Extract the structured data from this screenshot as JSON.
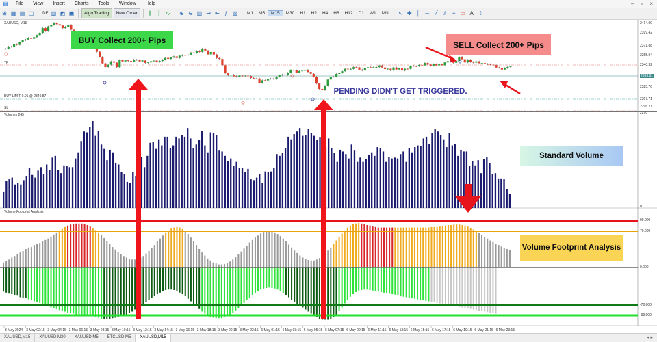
{
  "menu": {
    "items": [
      "File",
      "View",
      "Insert",
      "Charts",
      "Tools",
      "Window",
      "Help"
    ]
  },
  "toolbar": {
    "algo_trading": "Algo Trading",
    "new_order": "New Order",
    "timeframes": [
      "M1",
      "M5",
      "M15",
      "M30",
      "H1",
      "H2",
      "H4",
      "H6",
      "H12",
      "D1",
      "W1",
      "MN"
    ],
    "active_timeframe": "M15"
  },
  "chart": {
    "header": "XAUUSD, M15",
    "tp_label": "TP",
    "sl_label": "SL",
    "pending_label": "BUY LIMIT 0.01 @ 2340.87",
    "right_prices": [
      "2414.90",
      "2399.42",
      "2371.88",
      "2355.94",
      "2340.32",
      "2333.81",
      "2325.70",
      "2307.71",
      "2296.21",
      "2270"
    ],
    "candles": [
      2372.8,
      2375,
      2374.8,
      2377.5,
      2376.8,
      2379.4,
      2381.5,
      2382.3,
      2384.1,
      2383.1,
      2384.8,
      2386.9,
      2389.3,
      2394.2,
      2391,
      2396,
      2397.6,
      2399.8,
      2398.3,
      2397,
      2394.2,
      2395.7,
      2397.7,
      2392.5,
      2390.5,
      2388.3,
      2390,
      2386.9,
      2384.4,
      2384.8,
      2379.7,
      2376.8,
      2369.6,
      2364.2,
      2357.4,
      2353.6,
      2356,
      2359.5,
      2358.2,
      2353.4,
      2360.9,
      2359.5,
      2360.6,
      2359.9,
      2359.3,
      2361.4,
      2360.9,
      2359.5,
      2360.4,
      2357.9,
      2358.4,
      2359.7,
      2360.3,
      2358.9,
      2359.9,
      2361.2,
      2363.2,
      2362.1,
      2363.5,
      2364.7,
      2363.1,
      2365.4,
      2366.1,
      2365.8,
      2366.5,
      2368.7,
      2368.3,
      2370.4,
      2369.4,
      2372.9,
      2370.8,
      2366.8,
      2369.3,
      2366.6,
      2363,
      2362,
      2355.5,
      2347.1,
      2344.9,
      2345.7,
      2344,
      2343.4,
      2344.7,
      2344.2,
      2344.6,
      2344.1,
      2342.1,
      2341.5,
      2341.6,
      2337,
      2339.7,
      2339.5,
      2341.2,
      2341.5,
      2340.9,
      2343.4,
      2345,
      2345.8,
      2345.3,
      2347.6,
      2350.5,
      2350.1,
      2347.9,
      2349.4,
      2349.7,
      2350.7,
      2348.5,
      2346.6,
      2343.5,
      2336.3,
      2330.7,
      2329.5,
      2334.1,
      2340.5,
      2343.5,
      2343.5,
      2346.4,
      2347.3,
      2349.2,
      2351.7,
      2351.4,
      2351.6,
      2353.4,
      2353.2,
      2350.8,
      2349.9,
      2352.2,
      2353.3,
      2352.9,
      2353.3,
      2353.5,
      2355.2,
      2353.1,
      2351.4,
      2351.7,
      2350,
      2353.1,
      2351,
      2352.1,
      2349.9,
      2351.7,
      2351.6,
      2354.8,
      2354.5,
      2354.4,
      2355.8,
      2355.3,
      2357.8,
      2356.2,
      2354.9,
      2356.6,
      2355.3,
      2356.4,
      2355.5,
      2358.4,
      2359.7,
      2359.1,
      2358,
      2359.9,
      2364.3,
      2361.7,
      2358.4,
      2361.2,
      2358.9,
      2358.2,
      2359.5,
      2357.6,
      2357.7,
      2356.8,
      2356.5,
      2356,
      2355.6,
      2353.1,
      2352.7,
      2350.9,
      2352.5,
      2353.6,
      2354.2
    ],
    "annotations": {
      "buy": "BUY Collect 200+ Pips",
      "sell": "SELL Collect 200+ Pips",
      "pending": "PENDING DIDN'T GET TRIGGERED.",
      "standard_volume": "Standard Volume",
      "footprint": "Volume Footprint Analysis"
    },
    "colors": {
      "buy_box": "#3dd74a",
      "sell_box": "#f58b8b",
      "arrow": "#f0141b",
      "standard_volume_box": "#cde8f8",
      "footprint_box": "#fad455",
      "pending_text": "#3b3a9c",
      "volume_bar": "#1a1a6e",
      "fp_red": "#d9262a",
      "fp_orange": "#f0aa1e",
      "fp_gray": "#999999",
      "fp_darkgreen": "#0d5b12",
      "fp_green": "#2fe33a",
      "line_red": "#e8141b",
      "line_orange": "#e8a20a",
      "line_darkgreen": "#0f7a16",
      "line_green": "#24e02e"
    }
  },
  "volume_panel": {
    "title": "Volumes 245",
    "scale_top": "",
    "scale_bottom": "0",
    "values": [
      19,
      31,
      33,
      35,
      27,
      29,
      27,
      32,
      37,
      46,
      38,
      35,
      43,
      47,
      39,
      50,
      44,
      58,
      60,
      44,
      40,
      49,
      48,
      47,
      47,
      57,
      64,
      77,
      88,
      87,
      93,
      100,
      83,
      89,
      73,
      68,
      55,
      67,
      64,
      52,
      50,
      41,
      39,
      30,
      29,
      41,
      37,
      48,
      59,
      47,
      60,
      75,
      76,
      68,
      79,
      72,
      82,
      82,
      69,
      72,
      82,
      80,
      84,
      82,
      92,
      80,
      69,
      73,
      78,
      89,
      72,
      64,
      87,
      86,
      84,
      66,
      65,
      60,
      54,
      57,
      48,
      53,
      46,
      46,
      41,
      45,
      33,
      32,
      35,
      39,
      29,
      42,
      41,
      42,
      46,
      62,
      60,
      63,
      69,
      82,
      79,
      85,
      88,
      92,
      83,
      84,
      91,
      86,
      83,
      78,
      81,
      71,
      70,
      80,
      69,
      63,
      53,
      67,
      65,
      62,
      57,
      73,
      66,
      53,
      58,
      53,
      56,
      61,
      64,
      60,
      70,
      69,
      65,
      53,
      59,
      57,
      58,
      57,
      62,
      65,
      53,
      69,
      64,
      70,
      72,
      71,
      80,
      82,
      74,
      86,
      91,
      88,
      84,
      79,
      70,
      86,
      72,
      74,
      60,
      67,
      65,
      65,
      48,
      54,
      49,
      55,
      40,
      56,
      59,
      52,
      39,
      40,
      34,
      34,
      33,
      22,
      16
    ],
    "arrow_color": "#e8141b"
  },
  "footprint_panel": {
    "title": "Volume Footprint Analysis",
    "scale": [
      "99.000",
      "70.000",
      "0.000",
      "-70.000",
      "-99.000"
    ],
    "top_values": [
      10,
      13,
      16,
      20,
      23,
      27,
      30,
      33,
      37,
      40,
      41,
      45,
      48,
      49,
      52,
      55,
      58,
      62,
      66,
      70,
      74,
      77,
      81,
      84,
      86,
      87,
      88,
      88,
      88,
      87,
      85,
      82,
      79,
      75,
      70,
      65,
      59,
      53,
      47,
      41,
      36,
      31,
      27,
      23,
      20,
      17,
      16,
      16,
      17,
      20,
      23,
      28,
      33,
      39,
      45,
      52,
      58,
      64,
      70,
      74,
      78,
      80,
      81,
      80,
      77,
      73,
      67,
      60,
      53,
      45,
      37,
      30,
      24,
      18,
      14,
      10,
      8,
      6,
      6,
      7,
      9,
      12,
      16,
      21,
      26,
      32,
      38,
      44,
      50,
      55,
      60,
      64,
      68,
      71,
      72,
      73,
      72,
      70,
      67,
      63,
      58,
      52,
      46,
      40,
      34,
      29,
      24,
      20,
      17,
      15,
      14,
      14,
      16,
      19,
      23,
      28,
      34,
      40,
      47,
      54,
      61,
      68,
      74,
      80,
      84,
      87,
      88,
      89,
      88,
      87,
      85,
      84,
      82,
      81,
      80,
      80,
      80,
      80,
      80,
      80,
      80,
      80,
      80,
      80,
      80,
      80,
      80,
      80,
      80,
      80,
      80,
      80,
      80,
      81,
      81,
      81,
      82,
      83,
      84,
      85,
      85,
      86,
      86,
      86,
      85,
      84,
      82,
      79,
      76,
      72,
      69,
      65,
      61,
      58,
      54,
      51,
      48,
      45,
      42,
      39,
      37,
      35
    ],
    "top_colors": [
      "g",
      "g",
      "g",
      "g",
      "g",
      "g",
      "g",
      "g",
      "g",
      "g",
      "g",
      "g",
      "g",
      "g",
      "g",
      "g",
      "g",
      "g",
      "g",
      "g",
      "o",
      "o",
      "o",
      "r",
      "r",
      "r",
      "r",
      "r",
      "r",
      "r",
      "r",
      "r",
      "o",
      "o",
      "o",
      "g",
      "g",
      "g",
      "g",
      "g",
      "g",
      "g",
      "g",
      "g",
      "g",
      "g",
      "g",
      "g",
      "g",
      "g",
      "g",
      "g",
      "g",
      "g",
      "g",
      "g",
      "g",
      "g",
      "o",
      "o",
      "o",
      "o",
      "o",
      "o",
      "o",
      "g",
      "g",
      "g",
      "g",
      "g",
      "g",
      "g",
      "g",
      "g",
      "g",
      "g",
      "g",
      "g",
      "g",
      "g",
      "g",
      "g",
      "g",
      "g",
      "g",
      "g",
      "g",
      "g",
      "g",
      "g",
      "g",
      "g",
      "g",
      "g",
      "g",
      "g",
      "g",
      "g",
      "g",
      "g",
      "g",
      "g",
      "g",
      "g",
      "g",
      "g",
      "g",
      "g",
      "g",
      "g",
      "g",
      "g",
      "g",
      "g",
      "g",
      "g",
      "g",
      "g",
      "o",
      "o",
      "o",
      "o",
      "o",
      "o",
      "o",
      "o",
      "o",
      "o",
      "r",
      "r",
      "r",
      "r",
      "r",
      "r",
      "r",
      "r",
      "r",
      "r",
      "r",
      "r",
      "o",
      "o",
      "o",
      "o",
      "o",
      "o",
      "o",
      "o",
      "o",
      "o",
      "o",
      "o",
      "o",
      "o",
      "o",
      "o",
      "o",
      "o",
      "o",
      "o",
      "o",
      "o",
      "o",
      "o",
      "o",
      "o",
      "o",
      "o",
      "o",
      "o",
      "g",
      "g",
      "g",
      "g",
      "g",
      "g",
      "g",
      "g",
      "g",
      "g",
      "g"
    ],
    "bottom_values": [
      47,
      49,
      51,
      52,
      54,
      55,
      58,
      60,
      59,
      62,
      64,
      66,
      68,
      69,
      72,
      74,
      76,
      78,
      79,
      81,
      83,
      85,
      86,
      88,
      89,
      90,
      92,
      93,
      93,
      94,
      94,
      95,
      95,
      97,
      98,
      100,
      101,
      101,
      100,
      99,
      98,
      96,
      95,
      93,
      92,
      89,
      86,
      82,
      79,
      76,
      72,
      68,
      64,
      60,
      56,
      52,
      49,
      46,
      44,
      43,
      43,
      44,
      46,
      49,
      52,
      56,
      61,
      66,
      71,
      76,
      81,
      86,
      90,
      93,
      96,
      98,
      99,
      99,
      99,
      97,
      95,
      92,
      88,
      84,
      79,
      74,
      69,
      64,
      59,
      54,
      50,
      46,
      43,
      41,
      40,
      39,
      40,
      41,
      43,
      46,
      50,
      54,
      58,
      63,
      67,
      71,
      75,
      78,
      82,
      86,
      90,
      94,
      97,
      100,
      102,
      102,
      102,
      100,
      97,
      92,
      85,
      78,
      70,
      63,
      57,
      52,
      48,
      45,
      44,
      43,
      43,
      44,
      45,
      46,
      47,
      48,
      49,
      50,
      51,
      52,
      53,
      54,
      56,
      57,
      58,
      59,
      60,
      61,
      62,
      63,
      64,
      65,
      66,
      67,
      68,
      69,
      70,
      71,
      72,
      73,
      74,
      75,
      76,
      77,
      78,
      79,
      80,
      81,
      82,
      83,
      84,
      85,
      86,
      87,
      88,
      89,
      90
    ],
    "bottom_colors": [
      "d",
      "d",
      "d",
      "d",
      "d",
      "d",
      "d",
      "d",
      "d",
      "l",
      "l",
      "l",
      "l",
      "l",
      "l",
      "l",
      "l",
      "l",
      "l",
      "l",
      "l",
      "l",
      "l",
      "l",
      "l",
      "l",
      "l",
      "l",
      "l",
      "l",
      "l",
      "l",
      "l",
      "l",
      "l",
      "l",
      "d",
      "d",
      "d",
      "d",
      "d",
      "d",
      "d",
      "d",
      "d",
      "d",
      "d",
      "d",
      "d",
      "d",
      "d",
      "d",
      "d",
      "d",
      "d",
      "d",
      "d",
      "d",
      "d",
      "d",
      "d",
      "d",
      "d",
      "d",
      "d",
      "d",
      "d",
      "d",
      "d",
      "d",
      "d",
      "l",
      "l",
      "l",
      "l",
      "l",
      "l",
      "l",
      "l",
      "l",
      "l",
      "l",
      "l",
      "l",
      "l",
      "l",
      "l",
      "l",
      "l",
      "l",
      "l",
      "l",
      "l",
      "l",
      "l",
      "l",
      "l",
      "l",
      "l",
      "l",
      "l",
      "d",
      "d",
      "d",
      "d",
      "d",
      "d",
      "d",
      "d",
      "d",
      "d",
      "d",
      "d",
      "d",
      "d",
      "d",
      "d",
      "d",
      "d",
      "d",
      "l",
      "l",
      "l",
      "l",
      "l",
      "l",
      "l",
      "l",
      "l",
      "l",
      "l",
      "l",
      "l",
      "l",
      "l",
      "l",
      "l",
      "l",
      "l",
      "l",
      "l",
      "l",
      "l",
      "l",
      "l",
      "l",
      "l",
      "l",
      "l",
      "l",
      "l",
      "l",
      "l",
      "l",
      "l",
      "l",
      "l",
      "l",
      "l",
      "l",
      "l",
      "l",
      "l",
      "l",
      "l",
      "l",
      "l",
      "l",
      "l",
      "l",
      "l",
      "l",
      "l",
      "l",
      "l",
      "l",
      "l",
      "l",
      "l",
      "l",
      "l"
    ]
  },
  "time_axis": [
    "3 May 2024",
    "3 May 02:15",
    "3 May 04:15",
    "3 May 06:15",
    "3 May 08:15",
    "3 May 10:15",
    "3 May 12:15",
    "3 May 14:15",
    "3 May 16:15",
    "3 May 18:15",
    "3 May 20:15",
    "3 May 22:15",
    "6 May 01:15",
    "6 May 03:15",
    "6 May 05:15",
    "6 May 07:15",
    "6 May 09:15",
    "6 May 11:15",
    "6 May 13:15",
    "6 May 15:15",
    "6 May 17:15",
    "6 May 19:15",
    "6 May 21:15",
    "6 May 23:15"
  ],
  "tabs": [
    "XAUUSD,M15",
    "XAUUSD,M30",
    "XAUUSD,M5",
    "ETCUSD,M5",
    "XAUUSD,M15"
  ],
  "active_tab": 4
}
